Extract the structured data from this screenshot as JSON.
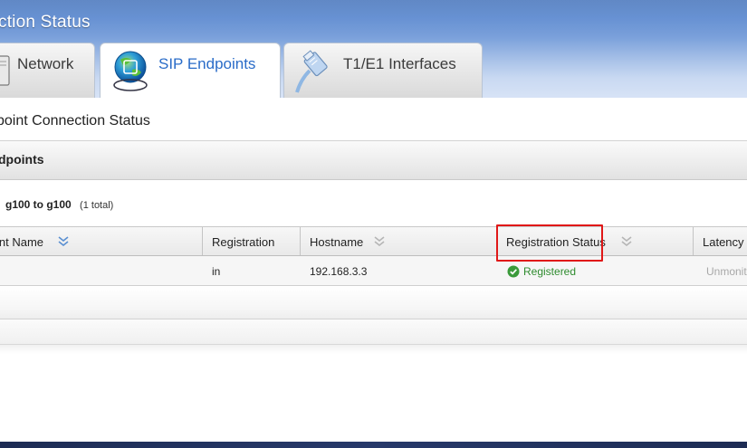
{
  "window": {
    "title": "ction Status"
  },
  "tabs": [
    {
      "label": "Network",
      "icon": "network-icon",
      "active": false
    },
    {
      "label": "SIP Endpoints",
      "icon": "globe-icon",
      "active": true
    },
    {
      "label": "T1/E1 Interfaces",
      "icon": "cable-icon",
      "active": false
    }
  ],
  "main": {
    "section_title": "point Connection Status",
    "panel_title": "dpoints",
    "range": {
      "text": "g100 to g100",
      "total": "(1 total)"
    },
    "columns": [
      {
        "label": "int Name",
        "sortable": true
      },
      {
        "label": "Registration",
        "sortable": false
      },
      {
        "label": "Hostname",
        "sortable": true
      },
      {
        "label": "Registration Status",
        "sortable": true
      },
      {
        "label": "Latency",
        "sortable": false
      }
    ],
    "rows": [
      {
        "name": "",
        "registration": "in",
        "hostname": "192.168.3.3",
        "status": "Registered",
        "status_icon": "check-circle-icon",
        "latency": "Unmonit"
      }
    ]
  },
  "colors": {
    "accent": "#2a6cc8",
    "status_ok": "#2e8b2e",
    "highlight": "#e01818",
    "header_top": "#4b78bd"
  }
}
